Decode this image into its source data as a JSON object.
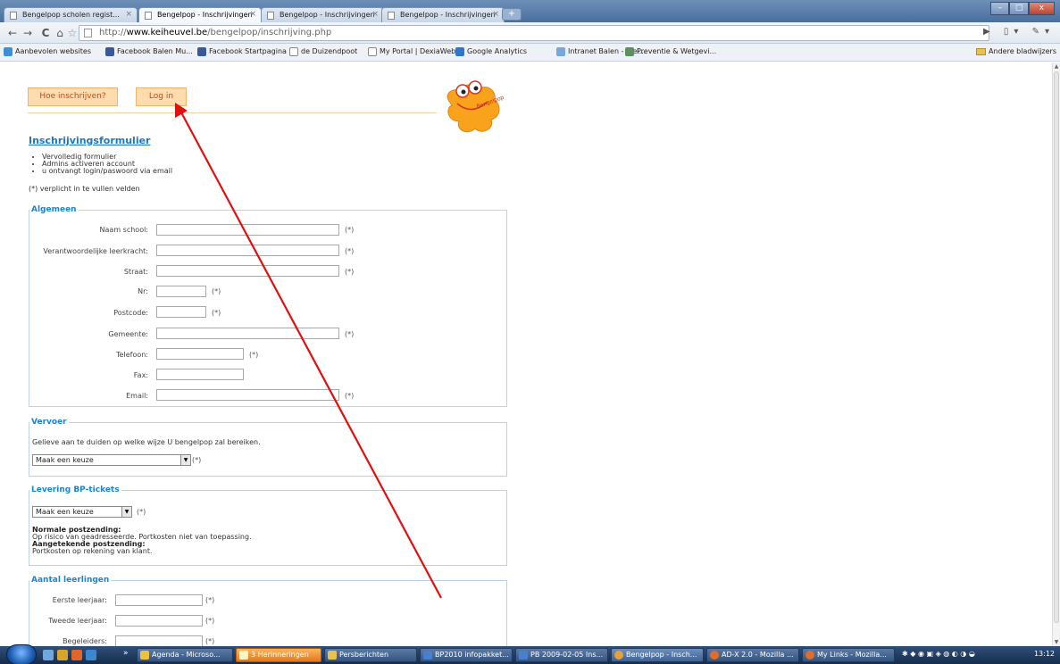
{
  "tabs": [
    {
      "label": "Bengelpop scholen regist..."
    },
    {
      "label": "Bengelpop - Inschrijvingen"
    },
    {
      "label": "Bengelpop - Inschrijvingen"
    },
    {
      "label": "Bengelpop - Inschrijvingen"
    }
  ],
  "address": {
    "prefix": "http://",
    "host": "www.keiheuvel.be",
    "path": "/bengelpop/inschrijving.php"
  },
  "bookmarks": [
    "Aanbevolen websites",
    "Facebook Balen Mu...",
    "Facebook Startpagina",
    "de Duizendpoot",
    "My Portal | DexiaWeb",
    "Google Analytics",
    "Intranet Balen - Wel...",
    "Preventie & Wetgevi..."
  ],
  "bookmarks_other": "Andere bladwijzers",
  "nav": {
    "how_label": "Hoe inschrijven?",
    "login_label": "Log in"
  },
  "mascot_text": "Bengelpop",
  "form": {
    "title": "Inschrijvingsformulier",
    "steps": [
      "Vervolledig formulier",
      "Admins activeren account",
      "u ontvangt login/paswoord via email"
    ],
    "required_note": "(*) verplicht in te vullen velden",
    "required_mark": "(*)",
    "algemeen": {
      "legend": "Algemeen",
      "fields": [
        {
          "label": "Naam school:"
        },
        {
          "label": "Verantwoordelijke leerkracht:"
        },
        {
          "label": "Straat:"
        },
        {
          "label": "Nr:"
        },
        {
          "label": "Postcode:"
        },
        {
          "label": "Gemeente:"
        },
        {
          "label": "Telefoon:"
        },
        {
          "label": "Fax:"
        },
        {
          "label": "Email:"
        }
      ]
    },
    "vervoer": {
      "legend": "Vervoer",
      "text": "Gelieve aan te duiden op welke wijze U bengelpop zal bereiken.",
      "select": "Maak een keuze"
    },
    "levering": {
      "legend": "Levering BP-tickets",
      "select": "Maak een keuze",
      "normal_title": "Normale postzending:",
      "normal_text": "Op risico van geadresseerde. Portkosten niet van toepassing.",
      "registered_title": "Aangetekende postzending:",
      "registered_text": "Portkosten op rekening van klant."
    },
    "leerlingen": {
      "legend": "Aantal leerlingen",
      "fields": [
        {
          "label": "Eerste leerjaar:"
        },
        {
          "label": "Tweede leerjaar:"
        },
        {
          "label": "Begeleiders:"
        }
      ]
    }
  },
  "taskbar": {
    "tasks": [
      "Agenda - Microso...",
      "3 Herinneringen",
      "Persberichten",
      "BP2010 infopakket...",
      "PB 2009-02-05 Ins...",
      "Bengelpop - Insch...",
      "AD-X 2.0 - Mozilla ...",
      "My Links - Mozilla..."
    ],
    "clock": "13:12"
  },
  "colors": {
    "accent": "#1b84d6",
    "peach": "#ffdcae",
    "peach_text": "#d2401a",
    "arrow": "#e01010"
  }
}
